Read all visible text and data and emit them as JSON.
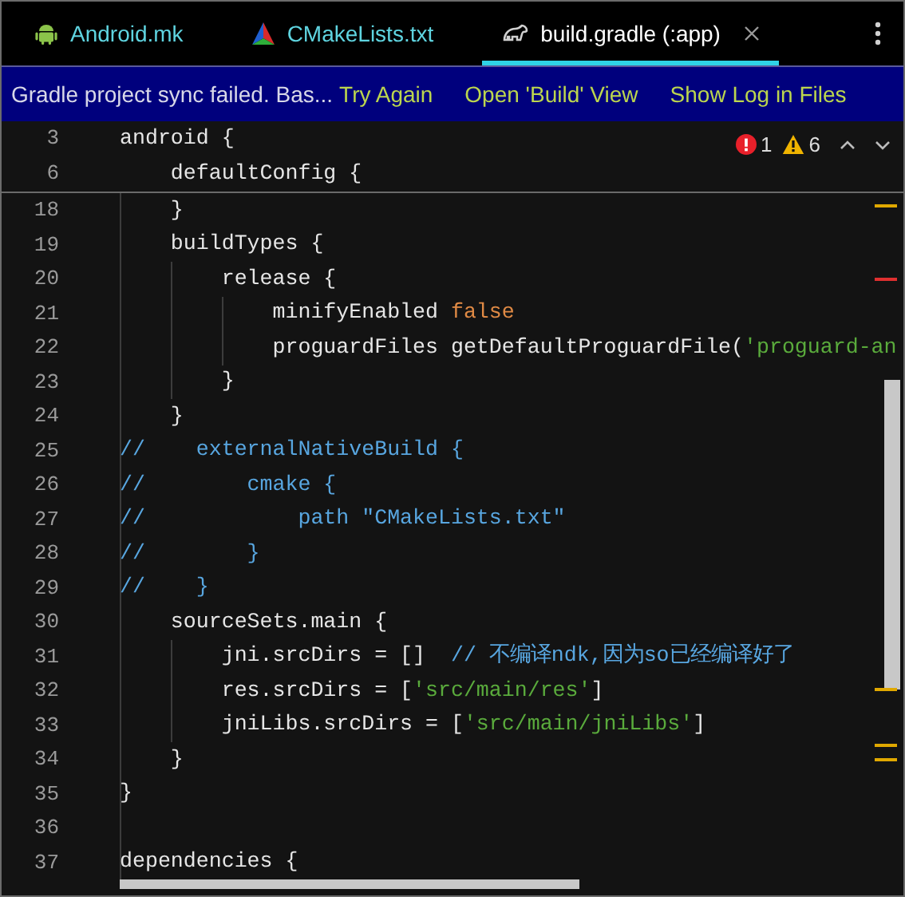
{
  "tabs": [
    {
      "label": "Android.mk",
      "kind": "android",
      "selected": false,
      "closable": false
    },
    {
      "label": "CMakeLists.txt",
      "kind": "cmake",
      "selected": false,
      "closable": false
    },
    {
      "label": "build.gradle (:app)",
      "kind": "gradle",
      "selected": true,
      "closable": true
    }
  ],
  "notification": {
    "message": "Gradle project sync failed. Bas...",
    "actions": [
      "Try Again",
      "Open 'Build' View",
      "Show Log in Files"
    ]
  },
  "inspections": {
    "errors": "1",
    "warnings": "6"
  },
  "sticky_lines": [
    {
      "number": "3",
      "segments": [
        {
          "kind": "plain",
          "text": "android {"
        }
      ]
    },
    {
      "number": "6",
      "segments": [
        {
          "kind": "plain",
          "text": "    defaultConfig {"
        }
      ]
    }
  ],
  "lines": [
    {
      "number": "18",
      "segments": [
        {
          "kind": "plain",
          "text": "    }"
        }
      ]
    },
    {
      "number": "19",
      "segments": [
        {
          "kind": "plain",
          "text": "    buildTypes {"
        }
      ]
    },
    {
      "number": "20",
      "segments": [
        {
          "kind": "plain",
          "text": "        release {"
        }
      ]
    },
    {
      "number": "21",
      "segments": [
        {
          "kind": "plain",
          "text": "            minifyEnabled "
        },
        {
          "kind": "keyword",
          "text": "false"
        }
      ]
    },
    {
      "number": "22",
      "segments": [
        {
          "kind": "plain",
          "text": "            proguardFiles getDefaultProguardFile("
        },
        {
          "kind": "string",
          "text": "'proguard-an"
        }
      ]
    },
    {
      "number": "23",
      "segments": [
        {
          "kind": "plain",
          "text": "        }"
        }
      ]
    },
    {
      "number": "24",
      "segments": [
        {
          "kind": "plain",
          "text": "    }"
        }
      ]
    },
    {
      "number": "25",
      "segments": [
        {
          "kind": "comment",
          "text": "//    externalNativeBuild {"
        }
      ]
    },
    {
      "number": "26",
      "segments": [
        {
          "kind": "comment",
          "text": "//        cmake {"
        }
      ]
    },
    {
      "number": "27",
      "segments": [
        {
          "kind": "comment",
          "text": "//            path \"CMakeLists.txt\""
        }
      ]
    },
    {
      "number": "28",
      "segments": [
        {
          "kind": "comment",
          "text": "//        }"
        }
      ]
    },
    {
      "number": "29",
      "segments": [
        {
          "kind": "comment",
          "text": "//    }"
        }
      ]
    },
    {
      "number": "30",
      "segments": [
        {
          "kind": "plain",
          "text": "    sourceSets.main {"
        }
      ]
    },
    {
      "number": "31",
      "segments": [
        {
          "kind": "plain",
          "text": "        jni.srcDirs = []  "
        },
        {
          "kind": "comment",
          "text": "// 不编译ndk,因为so已经编译好了"
        }
      ]
    },
    {
      "number": "32",
      "segments": [
        {
          "kind": "plain",
          "text": "        res.srcDirs = ["
        },
        {
          "kind": "string",
          "text": "'src/main/res'"
        },
        {
          "kind": "plain",
          "text": "]"
        }
      ]
    },
    {
      "number": "33",
      "segments": [
        {
          "kind": "plain",
          "text": "        jniLibs.srcDirs = ["
        },
        {
          "kind": "string",
          "text": "'src/main/jniLibs'"
        },
        {
          "kind": "plain",
          "text": "]"
        }
      ]
    },
    {
      "number": "34",
      "segments": [
        {
          "kind": "plain",
          "text": "    }"
        }
      ]
    },
    {
      "number": "35",
      "segments": [
        {
          "kind": "plain",
          "text": "}"
        }
      ]
    },
    {
      "number": "36"
    },
    {
      "number": "37",
      "segments": [
        {
          "kind": "plain",
          "text": "dependencies {"
        }
      ]
    }
  ]
}
